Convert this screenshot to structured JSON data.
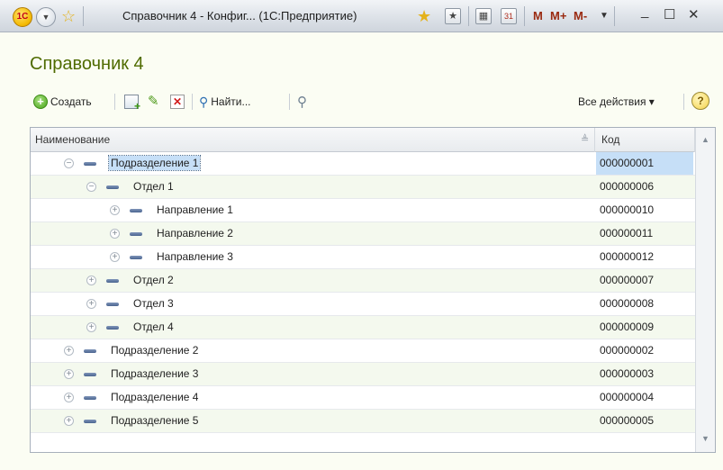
{
  "window": {
    "title": "Справочник 4 - Конфиг... (1С:Предприятие)",
    "logo_text": "1С",
    "menu_icon": "chevron-down-icon",
    "favorite_icon": "star-icon",
    "m_label": "M",
    "mplus_label": "M+",
    "mminus_label": "M-",
    "minimize_label": "_",
    "maximize_label": "☐",
    "close_label": "✕"
  },
  "form": {
    "title": "Справочник 4"
  },
  "toolbar": {
    "create_label": "Создать",
    "find_label": "Найти...",
    "all_actions_label": "Все действия ▾",
    "help_label": "?"
  },
  "table": {
    "columns": {
      "name": "Наименование",
      "code": "Код"
    },
    "rows": [
      {
        "name": "Подразделение 1",
        "code": "000000001",
        "level": 1,
        "expanded": true,
        "selected": true
      },
      {
        "name": "Отдел 1",
        "code": "000000006",
        "level": 2,
        "expanded": true
      },
      {
        "name": "Направление 1",
        "code": "000000010",
        "level": 3,
        "expanded": false
      },
      {
        "name": "Направление 2",
        "code": "000000011",
        "level": 3,
        "expanded": false
      },
      {
        "name": "Направление 3",
        "code": "000000012",
        "level": 3,
        "expanded": false
      },
      {
        "name": "Отдел 2",
        "code": "000000007",
        "level": 2,
        "expanded": false
      },
      {
        "name": "Отдел 3",
        "code": "000000008",
        "level": 2,
        "expanded": false
      },
      {
        "name": "Отдел 4",
        "code": "000000009",
        "level": 2,
        "expanded": false
      },
      {
        "name": "Подразделение 2",
        "code": "000000002",
        "level": 1,
        "expanded": false
      },
      {
        "name": "Подразделение 3",
        "code": "000000003",
        "level": 1,
        "expanded": false
      },
      {
        "name": "Подразделение 4",
        "code": "000000004",
        "level": 1,
        "expanded": false
      },
      {
        "name": "Подразделение 5",
        "code": "000000005",
        "level": 1,
        "expanded": false
      }
    ]
  },
  "colors": {
    "title_green": "#4f6b00",
    "selection": "#c6dff7",
    "alt_row": "#f4f9ee"
  }
}
